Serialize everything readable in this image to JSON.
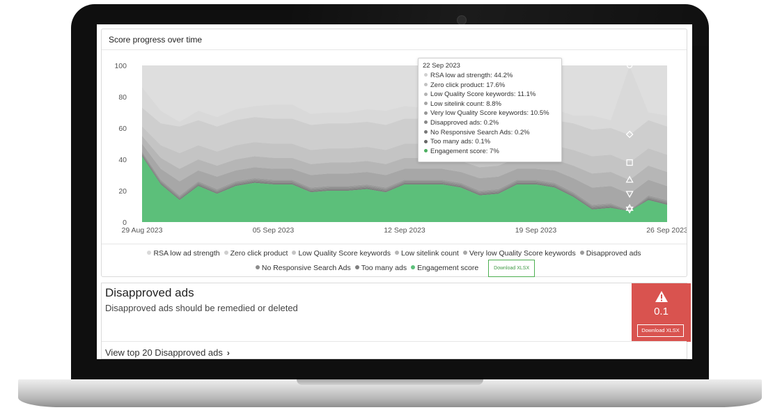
{
  "chart_card": {
    "title": "Score progress over time",
    "download_label": "Download XLSX"
  },
  "chart_data": {
    "type": "area",
    "stacked": true,
    "ylim": [
      0,
      100
    ],
    "yticks": [
      0,
      20,
      40,
      60,
      80,
      100
    ],
    "x_labels": [
      "29 Aug 2023",
      "05 Sep 2023",
      "12 Sep 2023",
      "19 Sep 2023",
      "26 Sep 2023"
    ],
    "x_label_index": [
      0,
      7,
      14,
      21,
      28
    ],
    "x_count": 29,
    "grid": false,
    "series": [
      {
        "name": "Engagement score",
        "color": "#5cbf7a",
        "values": [
          42,
          24,
          14,
          23,
          18,
          23,
          25,
          24,
          24,
          19,
          20,
          20,
          21,
          19,
          24,
          24,
          24,
          22,
          17,
          18,
          24,
          24,
          22,
          16,
          8,
          9,
          7,
          14,
          11
        ]
      },
      {
        "name": "Too many ads",
        "color": "#7f7f7f",
        "values": [
          1,
          1,
          1,
          1,
          1,
          1,
          1,
          1,
          1,
          1,
          1,
          1,
          1,
          1,
          1,
          1,
          1,
          1,
          1,
          1,
          1,
          1,
          1,
          1,
          1,
          1,
          0.1,
          1,
          1
        ]
      },
      {
        "name": "No Responsive Search Ads",
        "color": "#8c8c8c",
        "values": [
          1,
          1,
          1,
          1,
          1,
          1,
          1,
          1,
          1,
          1,
          1,
          1,
          1,
          1,
          1,
          1,
          1,
          1,
          1,
          1,
          1,
          1,
          1,
          1,
          1,
          1,
          0.2,
          1,
          1
        ]
      },
      {
        "name": "Disapproved ads",
        "color": "#9a9a9a",
        "values": [
          1,
          1,
          1,
          1,
          1,
          1,
          1,
          1,
          1,
          1,
          1,
          1,
          1,
          1,
          1,
          1,
          1,
          1,
          1,
          1,
          1,
          1,
          1,
          1,
          1,
          1,
          0.2,
          1,
          1
        ]
      },
      {
        "name": "Very low Quality Score keywords",
        "color": "#a7a7a7",
        "values": [
          5,
          7,
          9,
          7,
          8,
          7,
          7,
          7,
          7,
          8,
          8,
          8,
          8,
          8,
          7,
          7,
          7,
          7,
          8,
          8,
          7,
          7,
          8,
          9,
          11,
          11,
          10.5,
          10,
          9
        ]
      },
      {
        "name": "Low sitelink count",
        "color": "#b6b6b6",
        "values": [
          5,
          7,
          8,
          7,
          7,
          7,
          7,
          7,
          7,
          7,
          7,
          7,
          7,
          7,
          7,
          7,
          7,
          7,
          7,
          7,
          7,
          7,
          7,
          8,
          9,
          9,
          8.8,
          9,
          9
        ]
      },
      {
        "name": "Low Quality Score keywords",
        "color": "#c4c4c4",
        "values": [
          6,
          8,
          10,
          9,
          9,
          9,
          9,
          9,
          9,
          9,
          9,
          9,
          9,
          9,
          9,
          9,
          9,
          9,
          9,
          9,
          9,
          9,
          9,
          10,
          11,
          11,
          11.1,
          11,
          11
        ]
      },
      {
        "name": "Zero click product",
        "color": "#cecece",
        "values": [
          12,
          14,
          17,
          16,
          16,
          16,
          16,
          16,
          16,
          16,
          16,
          16,
          16,
          16,
          16,
          16,
          16,
          16,
          16,
          16,
          16,
          16,
          16,
          17,
          17,
          17,
          17.6,
          18,
          18
        ]
      },
      {
        "name": "RSA low ad strength",
        "color": "#d9d9d9",
        "values": [
          13,
          8,
          3,
          6,
          6,
          7,
          7,
          9,
          9,
          7,
          7,
          7,
          8,
          9,
          8,
          7,
          7,
          8,
          7,
          6,
          7,
          7,
          7,
          5,
          9,
          5,
          44.2,
          5,
          7
        ]
      }
    ],
    "tooltip": {
      "date": "22 Sep 2023",
      "rows": [
        {
          "label": "RSA low ad strength",
          "value": "44.2%",
          "color": "#d0d0d0"
        },
        {
          "label": "Zero click product",
          "value": "17.6%",
          "color": "#c2c2c2"
        },
        {
          "label": "Low Quality Score keywords",
          "value": "11.1%",
          "color": "#b3b3b3"
        },
        {
          "label": "Low sitelink count",
          "value": "8.8%",
          "color": "#a5a5a5"
        },
        {
          "label": "Very low Quality Score keywords",
          "value": "10.5%",
          "color": "#969696"
        },
        {
          "label": "Disapproved ads",
          "value": "0.2%",
          "color": "#888888"
        },
        {
          "label": "No Responsive Search Ads",
          "value": "0.2%",
          "color": "#777777"
        },
        {
          "label": "Too many ads",
          "value": "0.1%",
          "color": "#666666"
        },
        {
          "label": "Engagement score",
          "value": "7%",
          "color": "#4caf60"
        }
      ]
    }
  },
  "legend": [
    {
      "label": "RSA low ad strength",
      "color": "#d9d9d9"
    },
    {
      "label": "Zero click product",
      "color": "#cecece"
    },
    {
      "label": "Low Quality Score keywords",
      "color": "#c4c4c4"
    },
    {
      "label": "Low sitelink count",
      "color": "#b6b6b6"
    },
    {
      "label": "Very low Quality Score keywords",
      "color": "#a7a7a7"
    },
    {
      "label": "Disapproved ads",
      "color": "#9a9a9a"
    },
    {
      "label": "No Responsive Search Ads",
      "color": "#8c8c8c"
    },
    {
      "label": "Too many ads",
      "color": "#7f7f7f"
    },
    {
      "label": "Engagement score",
      "color": "#5cbf7a"
    }
  ],
  "disapproved": {
    "title": "Disapproved ads",
    "subtitle": "Disapproved ads should be remedied or deleted",
    "score": "0.1",
    "score_color": "#d9534f",
    "icon": "warning-icon",
    "download_label": "Download XLSX",
    "view_link": "View top 20 Disapproved ads"
  }
}
